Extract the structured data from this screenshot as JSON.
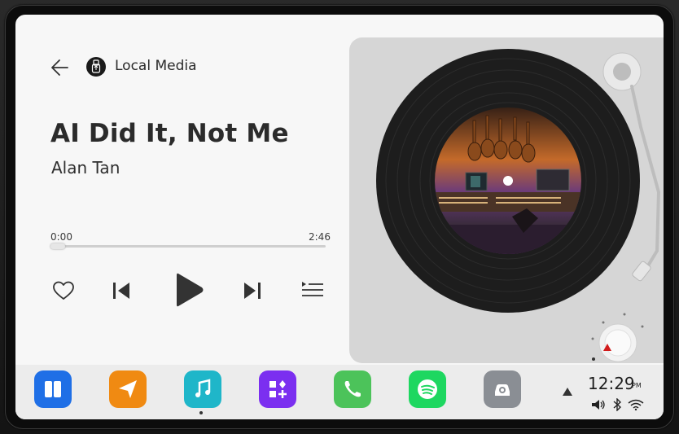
{
  "header": {
    "source_label": "Local Media",
    "back_icon": "back-arrow-icon",
    "source_icon": "usb-icon"
  },
  "track": {
    "title": "AI Did It, Not Me",
    "artist": "Alan Tan"
  },
  "progress": {
    "elapsed": "0:00",
    "duration": "2:46",
    "fraction": 0.0
  },
  "controls": [
    "heart-icon",
    "previous-icon",
    "play-icon",
    "next-icon",
    "playlist-icon"
  ],
  "dock": {
    "apps": [
      {
        "name": "split-screen-app",
        "color": "#1f6fe6"
      },
      {
        "name": "navigation-app",
        "color": "#f08a12"
      },
      {
        "name": "music-app",
        "color": "#1fb6c9",
        "active": true
      },
      {
        "name": "apps-grid-app",
        "color": "#7b2ff0"
      },
      {
        "name": "phone-app",
        "color": "#4cc35a"
      },
      {
        "name": "spotify-app",
        "color": "#1ed760"
      },
      {
        "name": "car-settings-app",
        "color": "#8a8e94"
      }
    ],
    "time": "12:29",
    "ampm": "PM"
  }
}
